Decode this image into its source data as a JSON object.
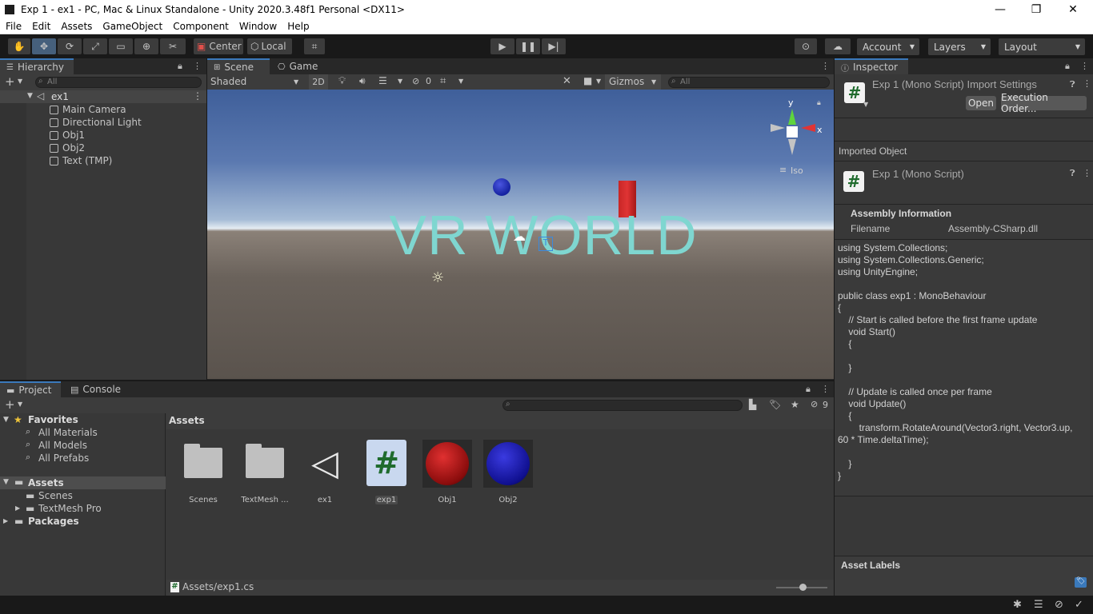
{
  "window": {
    "title": "Exp 1 - ex1 - PC, Mac & Linux Standalone - Unity 2020.3.48f1 Personal <DX11>",
    "minimize": "—",
    "maximize": "❐",
    "close": "✕"
  },
  "menu": [
    "File",
    "Edit",
    "Assets",
    "GameObject",
    "Component",
    "Window",
    "Help"
  ],
  "toolbar": {
    "pivot": "Center",
    "space": "Local",
    "account": "Account",
    "layers": "Layers",
    "layout": "Layout"
  },
  "hierarchy": {
    "tab": "Hierarchy",
    "search_placeholder": "All",
    "scene": "ex1",
    "items": [
      "Main Camera",
      "Directional Light",
      "Obj1",
      "Obj2",
      "Text (TMP)"
    ]
  },
  "scene": {
    "tabs": [
      "Scene",
      "Game"
    ],
    "shading": "Shaded",
    "mode2d": "2D",
    "hidden_count": "0",
    "gizmos": "Gizmos",
    "search_placeholder": "All",
    "world_text": "VR WORLD",
    "axis_y": "y",
    "axis_x": "x",
    "projection": "Iso"
  },
  "project": {
    "tabs": [
      "Project",
      "Console"
    ],
    "favorites": {
      "label": "Favorites",
      "items": [
        "All Materials",
        "All Models",
        "All Prefabs"
      ]
    },
    "assets_root": "Assets",
    "asset_folders": [
      "Scenes",
      "TextMesh Pro"
    ],
    "packages": "Packages",
    "breadcrumb": "Assets",
    "hidden_count": "9",
    "assets": [
      {
        "label": "Scenes",
        "kind": "folder"
      },
      {
        "label": "TextMesh ...",
        "kind": "folder"
      },
      {
        "label": "ex1",
        "kind": "unity-scene"
      },
      {
        "label": "exp1",
        "kind": "script"
      },
      {
        "label": "Obj1",
        "kind": "material",
        "color": "#c41414"
      },
      {
        "label": "Obj2",
        "kind": "material",
        "color": "#1a1ab8"
      }
    ],
    "status_path": "Assets/exp1.cs"
  },
  "inspector": {
    "tab": "Inspector",
    "header_title": "Exp 1 (Mono Script) Import Settings",
    "open_button": "Open",
    "execution_order_button": "Execution Order...",
    "imported_object_label": "Imported Object",
    "object_title": "Exp 1 (Mono Script)",
    "assembly_header": "Assembly Information",
    "filename_label": "Filename",
    "filename_value": "Assembly-CSharp.dll",
    "code": "using System.Collections;\nusing System.Collections.Generic;\nusing UnityEngine;\n\npublic class exp1 : MonoBehaviour\n{\n    // Start is called before the first frame update\n    void Start()\n    {\n\n    }\n\n    // Update is called once per frame\n    void Update()\n    {\n        transform.RotateAround(Vector3.right, Vector3.up,\n60 * Time.deltaTime);\n\n    }\n}",
    "asset_labels": "Asset Labels"
  },
  "colors": {
    "accent": "#3a79bb",
    "panel": "#383838",
    "text_teal": "#7fd6d0"
  }
}
